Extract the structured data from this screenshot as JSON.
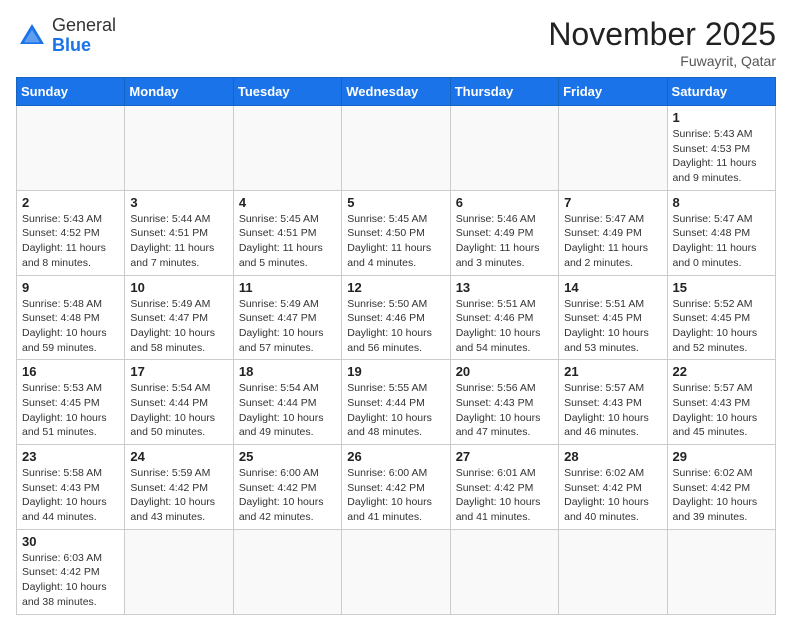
{
  "logo": {
    "line1": "General",
    "line2": "Blue"
  },
  "title": "November 2025",
  "location": "Fuwayrit, Qatar",
  "days_of_week": [
    "Sunday",
    "Monday",
    "Tuesday",
    "Wednesday",
    "Thursday",
    "Friday",
    "Saturday"
  ],
  "weeks": [
    [
      {
        "day": "",
        "info": ""
      },
      {
        "day": "",
        "info": ""
      },
      {
        "day": "",
        "info": ""
      },
      {
        "day": "",
        "info": ""
      },
      {
        "day": "",
        "info": ""
      },
      {
        "day": "",
        "info": ""
      },
      {
        "day": "1",
        "info": "Sunrise: 5:43 AM\nSunset: 4:53 PM\nDaylight: 11 hours and 9 minutes."
      }
    ],
    [
      {
        "day": "2",
        "info": "Sunrise: 5:43 AM\nSunset: 4:52 PM\nDaylight: 11 hours and 8 minutes."
      },
      {
        "day": "3",
        "info": "Sunrise: 5:44 AM\nSunset: 4:51 PM\nDaylight: 11 hours and 7 minutes."
      },
      {
        "day": "4",
        "info": "Sunrise: 5:45 AM\nSunset: 4:51 PM\nDaylight: 11 hours and 5 minutes."
      },
      {
        "day": "5",
        "info": "Sunrise: 5:45 AM\nSunset: 4:50 PM\nDaylight: 11 hours and 4 minutes."
      },
      {
        "day": "6",
        "info": "Sunrise: 5:46 AM\nSunset: 4:49 PM\nDaylight: 11 hours and 3 minutes."
      },
      {
        "day": "7",
        "info": "Sunrise: 5:47 AM\nSunset: 4:49 PM\nDaylight: 11 hours and 2 minutes."
      },
      {
        "day": "8",
        "info": "Sunrise: 5:47 AM\nSunset: 4:48 PM\nDaylight: 11 hours and 0 minutes."
      }
    ],
    [
      {
        "day": "9",
        "info": "Sunrise: 5:48 AM\nSunset: 4:48 PM\nDaylight: 10 hours and 59 minutes."
      },
      {
        "day": "10",
        "info": "Sunrise: 5:49 AM\nSunset: 4:47 PM\nDaylight: 10 hours and 58 minutes."
      },
      {
        "day": "11",
        "info": "Sunrise: 5:49 AM\nSunset: 4:47 PM\nDaylight: 10 hours and 57 minutes."
      },
      {
        "day": "12",
        "info": "Sunrise: 5:50 AM\nSunset: 4:46 PM\nDaylight: 10 hours and 56 minutes."
      },
      {
        "day": "13",
        "info": "Sunrise: 5:51 AM\nSunset: 4:46 PM\nDaylight: 10 hours and 54 minutes."
      },
      {
        "day": "14",
        "info": "Sunrise: 5:51 AM\nSunset: 4:45 PM\nDaylight: 10 hours and 53 minutes."
      },
      {
        "day": "15",
        "info": "Sunrise: 5:52 AM\nSunset: 4:45 PM\nDaylight: 10 hours and 52 minutes."
      }
    ],
    [
      {
        "day": "16",
        "info": "Sunrise: 5:53 AM\nSunset: 4:45 PM\nDaylight: 10 hours and 51 minutes."
      },
      {
        "day": "17",
        "info": "Sunrise: 5:54 AM\nSunset: 4:44 PM\nDaylight: 10 hours and 50 minutes."
      },
      {
        "day": "18",
        "info": "Sunrise: 5:54 AM\nSunset: 4:44 PM\nDaylight: 10 hours and 49 minutes."
      },
      {
        "day": "19",
        "info": "Sunrise: 5:55 AM\nSunset: 4:44 PM\nDaylight: 10 hours and 48 minutes."
      },
      {
        "day": "20",
        "info": "Sunrise: 5:56 AM\nSunset: 4:43 PM\nDaylight: 10 hours and 47 minutes."
      },
      {
        "day": "21",
        "info": "Sunrise: 5:57 AM\nSunset: 4:43 PM\nDaylight: 10 hours and 46 minutes."
      },
      {
        "day": "22",
        "info": "Sunrise: 5:57 AM\nSunset: 4:43 PM\nDaylight: 10 hours and 45 minutes."
      }
    ],
    [
      {
        "day": "23",
        "info": "Sunrise: 5:58 AM\nSunset: 4:43 PM\nDaylight: 10 hours and 44 minutes."
      },
      {
        "day": "24",
        "info": "Sunrise: 5:59 AM\nSunset: 4:42 PM\nDaylight: 10 hours and 43 minutes."
      },
      {
        "day": "25",
        "info": "Sunrise: 6:00 AM\nSunset: 4:42 PM\nDaylight: 10 hours and 42 minutes."
      },
      {
        "day": "26",
        "info": "Sunrise: 6:00 AM\nSunset: 4:42 PM\nDaylight: 10 hours and 41 minutes."
      },
      {
        "day": "27",
        "info": "Sunrise: 6:01 AM\nSunset: 4:42 PM\nDaylight: 10 hours and 41 minutes."
      },
      {
        "day": "28",
        "info": "Sunrise: 6:02 AM\nSunset: 4:42 PM\nDaylight: 10 hours and 40 minutes."
      },
      {
        "day": "29",
        "info": "Sunrise: 6:02 AM\nSunset: 4:42 PM\nDaylight: 10 hours and 39 minutes."
      }
    ],
    [
      {
        "day": "30",
        "info": "Sunrise: 6:03 AM\nSunset: 4:42 PM\nDaylight: 10 hours and 38 minutes."
      },
      {
        "day": "",
        "info": ""
      },
      {
        "day": "",
        "info": ""
      },
      {
        "day": "",
        "info": ""
      },
      {
        "day": "",
        "info": ""
      },
      {
        "day": "",
        "info": ""
      },
      {
        "day": "",
        "info": ""
      }
    ]
  ]
}
